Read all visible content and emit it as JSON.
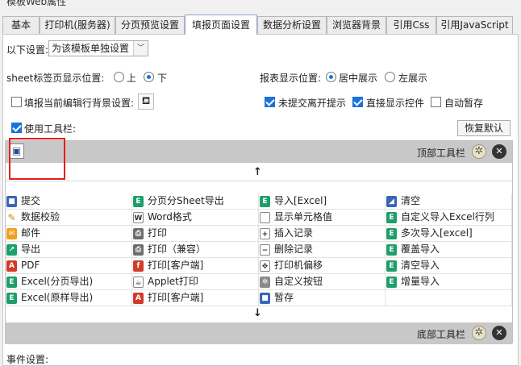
{
  "window": {
    "title": "模板Web属性"
  },
  "tabs": [
    {
      "label": "基本",
      "active": false
    },
    {
      "label": "打印机(服务器)",
      "active": false
    },
    {
      "label": "分页预览设置",
      "active": false
    },
    {
      "label": "填报页面设置",
      "active": true
    },
    {
      "label": "数据分析设置",
      "active": false
    },
    {
      "label": "浏览器背景",
      "active": false
    },
    {
      "label": "引用Css",
      "active": false
    },
    {
      "label": "引用JavaScript",
      "active": false
    }
  ],
  "settings": {
    "label": "以下设置:",
    "select_value": "为该模板单独设置"
  },
  "sheet_tab": {
    "label": "sheet标签页显示位置:",
    "options": [
      "上",
      "下"
    ],
    "selected": "下"
  },
  "report_pos": {
    "label": "报表显示位置:",
    "options": [
      "居中展示",
      "左展示"
    ],
    "selected": "居中展示"
  },
  "checks": {
    "highlight_row": {
      "label": "填报当前编辑行背景设置:",
      "checked": false
    },
    "unsubmitted_leave": {
      "label": "未提交离开提示",
      "checked": true
    },
    "direct_widget": {
      "label": "直接显示控件",
      "checked": true
    },
    "auto_save": {
      "label": "自动暂存",
      "checked": false
    },
    "use_toolbar": {
      "label": "使用工具栏:",
      "checked": true
    }
  },
  "restore_button": "恢复默认",
  "top_toolbar": {
    "label": "顶部工具栏",
    "up_arrow": "↑"
  },
  "bottom_toolbar": {
    "label": "底部工具栏",
    "down_arrow": "↓"
  },
  "buttons_grid": [
    [
      {
        "label": "提交",
        "icon": "save-icon"
      },
      {
        "label": "分页分Sheet导出",
        "icon": "excel-icon"
      },
      {
        "label": "导入[Excel]",
        "icon": "excel-icon"
      },
      {
        "label": "清空",
        "icon": "eraser-icon"
      }
    ],
    [
      {
        "label": "数据校验",
        "icon": "pencil-icon"
      },
      {
        "label": "Word格式",
        "icon": "word-icon"
      },
      {
        "label": "显示单元格值",
        "icon": "cell-icon"
      },
      {
        "label": "自定义导入Excel行列",
        "icon": "excel-icon"
      }
    ],
    [
      {
        "label": "邮件",
        "icon": "mail-icon"
      },
      {
        "label": "打印",
        "icon": "printer-icon"
      },
      {
        "label": "插入记录",
        "icon": "insert-row-icon"
      },
      {
        "label": "多次导入[excel]",
        "icon": "excel-icon"
      }
    ],
    [
      {
        "label": "导出",
        "icon": "export-icon"
      },
      {
        "label": "打印（兼容）",
        "icon": "printer-icon"
      },
      {
        "label": "删除记录",
        "icon": "delete-row-icon"
      },
      {
        "label": "覆盖导入",
        "icon": "excel-icon"
      }
    ],
    [
      {
        "label": "PDF",
        "icon": "pdf-icon"
      },
      {
        "label": "打印[客户端]",
        "icon": "flash-print-icon"
      },
      {
        "label": "打印机偏移",
        "icon": "move-icon"
      },
      {
        "label": "清空导入",
        "icon": "excel-icon"
      }
    ],
    [
      {
        "label": "Excel(分页导出)",
        "icon": "excel-icon"
      },
      {
        "label": "Applet打印",
        "icon": "applet-icon"
      },
      {
        "label": "自定义按钮",
        "icon": "gear-icon"
      },
      {
        "label": "增量导入",
        "icon": "excel-icon"
      }
    ],
    [
      {
        "label": "Excel(原样导出)",
        "icon": "excel-icon"
      },
      {
        "label": "打印[客户端]",
        "icon": "pdf-print-icon"
      },
      {
        "label": "暂存",
        "icon": "save-icon"
      },
      {
        "label": "",
        "icon": ""
      }
    ]
  ],
  "events": {
    "label": "事件设置:"
  }
}
